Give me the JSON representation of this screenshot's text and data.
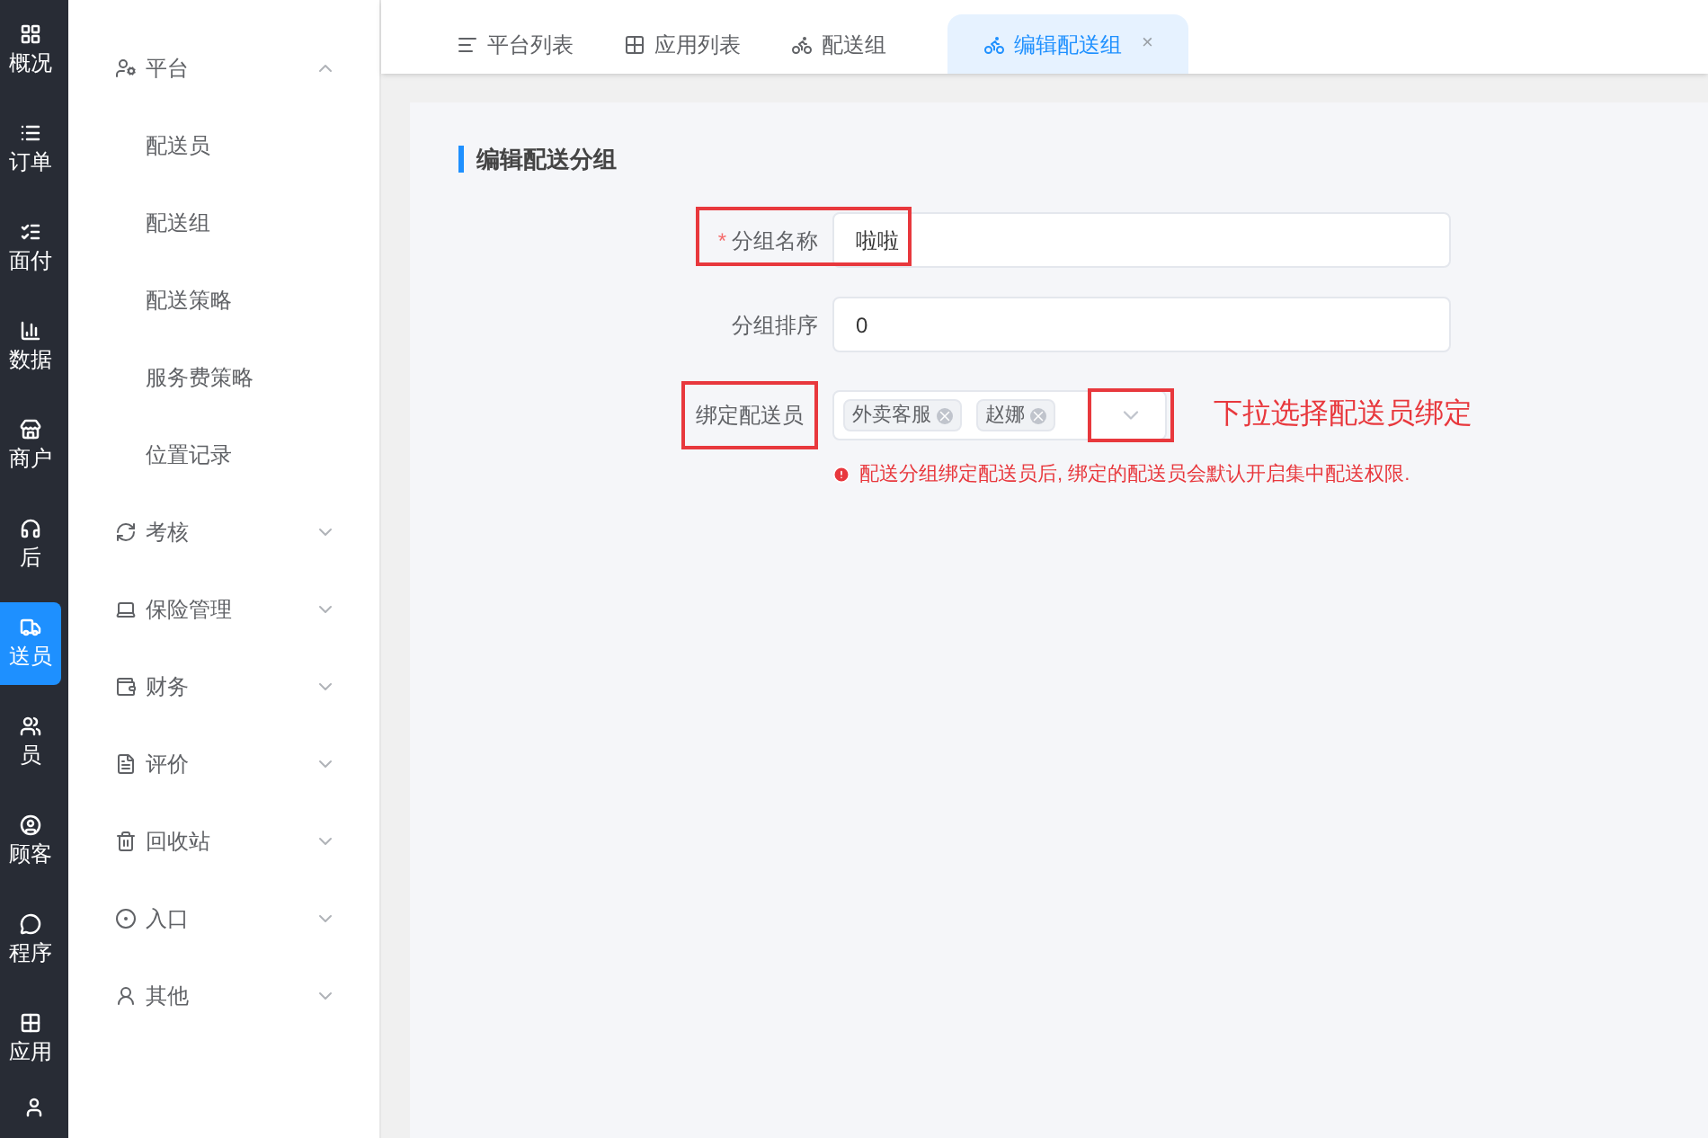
{
  "rail": [
    {
      "label": "概况",
      "selected": false
    },
    {
      "label": "订单",
      "selected": false
    },
    {
      "label": "面付",
      "selected": false
    },
    {
      "label": "数据",
      "selected": false
    },
    {
      "label": "商户",
      "selected": false
    },
    {
      "label": "后",
      "selected": false
    },
    {
      "label": "送员",
      "selected": true
    },
    {
      "label": "员",
      "selected": false
    },
    {
      "label": "顾客",
      "selected": false
    },
    {
      "label": "程序",
      "selected": false
    },
    {
      "label": "应用",
      "selected": false
    }
  ],
  "menu": [
    {
      "label": "平台",
      "expanded": true,
      "children": [
        {
          "label": "配送员"
        },
        {
          "label": "配送组"
        },
        {
          "label": "配送策略"
        },
        {
          "label": "服务费策略"
        },
        {
          "label": "位置记录"
        }
      ]
    },
    {
      "label": "考核",
      "expanded": false
    },
    {
      "label": "保险管理",
      "expanded": false
    },
    {
      "label": "财务",
      "expanded": false
    },
    {
      "label": "评价",
      "expanded": false
    },
    {
      "label": "回收站",
      "expanded": false
    },
    {
      "label": "入口",
      "expanded": false
    },
    {
      "label": "其他",
      "expanded": false
    }
  ],
  "tabs": [
    {
      "label": "平台列表",
      "kind": "list",
      "selected": false
    },
    {
      "label": "应用列表",
      "kind": "apps",
      "selected": false
    },
    {
      "label": "配送组",
      "kind": "delivery",
      "selected": false
    },
    {
      "label": "编辑配送组",
      "kind": "delivery",
      "selected": true,
      "close": "×"
    }
  ],
  "form": {
    "title": "编辑配送分组",
    "toggle_boxed": true,
    "fields": [
      {
        "kind": "input",
        "label": "分组名称",
        "required_mark": "*",
        "value": "啦啦",
        "boxed": true
      },
      {
        "kind": "input",
        "label": "分组排序",
        "value": "0",
        "boxed": false
      },
      {
        "kind": "tags",
        "label": "绑定配送员",
        "tags": [
          "外卖客服",
          "赵娜"
        ],
        "hint": "配送分组绑定配送员后, 绑定的配送员会默认开启集中配送权限.",
        "boxed": true
      }
    ],
    "annotation": "下拉选择配送员绑定"
  }
}
